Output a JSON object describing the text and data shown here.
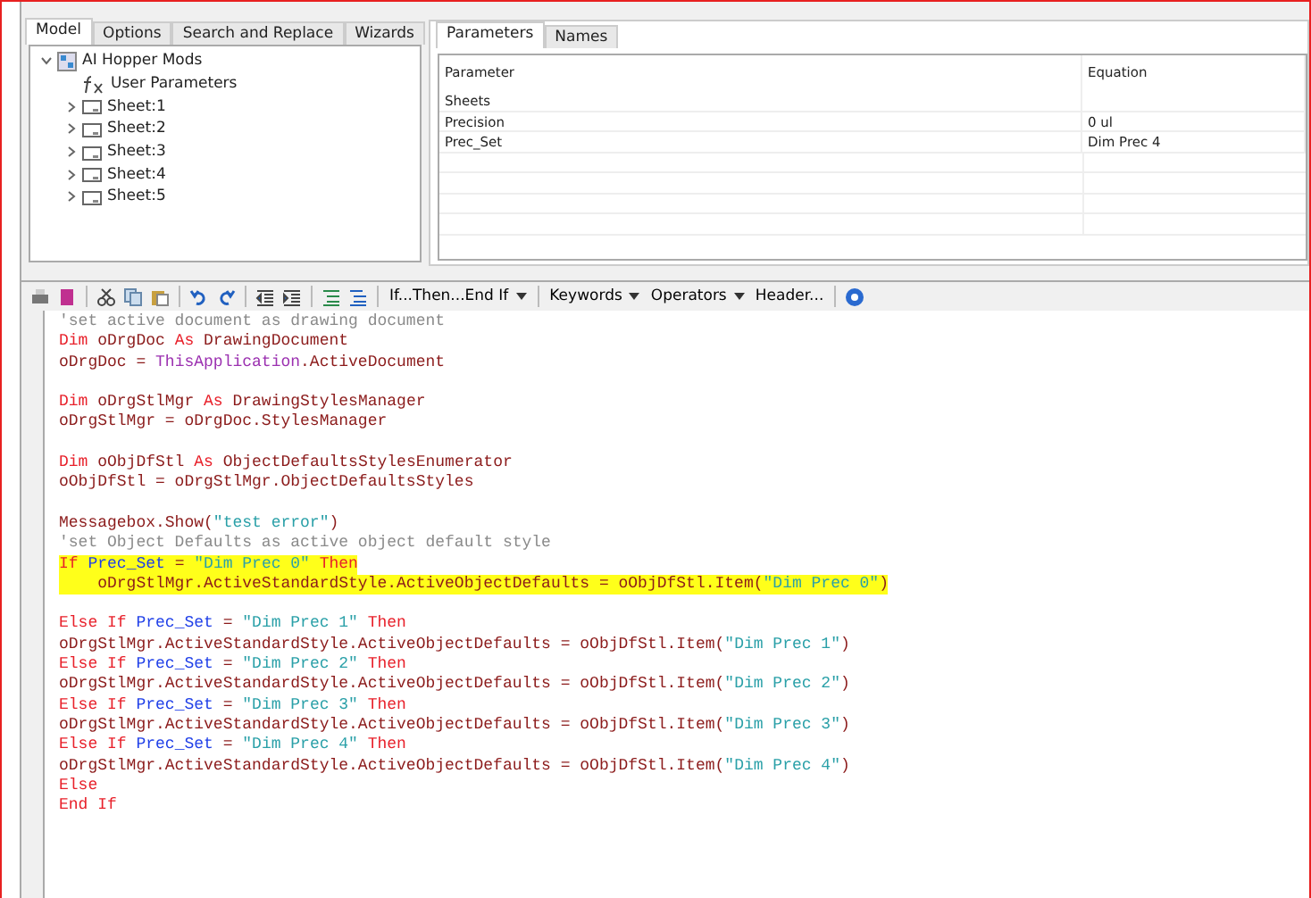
{
  "main_tabs": [
    {
      "label": "Model",
      "selected": true
    },
    {
      "label": "Options",
      "selected": false
    },
    {
      "label": "Search and Replace",
      "selected": false
    },
    {
      "label": "Wizards",
      "selected": false
    }
  ],
  "tree": [
    {
      "label": "AI Hopper Mods",
      "kind": "assembly",
      "expanded": true,
      "children": [
        {
          "label": "User Parameters",
          "kind": "parameters"
        },
        {
          "label": "Sheet:1",
          "kind": "sheet",
          "expanded": false
        },
        {
          "label": "Sheet:2",
          "kind": "sheet",
          "expanded": false
        },
        {
          "label": "Sheet:3",
          "kind": "sheet",
          "expanded": false
        },
        {
          "label": "Sheet:4",
          "kind": "sheet",
          "expanded": false
        },
        {
          "label": "Sheet:5",
          "kind": "sheet",
          "expanded": false
        }
      ]
    }
  ],
  "param_tabs": [
    {
      "label": "Parameters",
      "selected": true
    },
    {
      "label": "Names",
      "selected": false
    }
  ],
  "param_table": {
    "columns": [
      "Parameter",
      "Equation"
    ],
    "rows": [
      [
        "Sheets",
        ""
      ],
      [
        "Precision",
        "0 ul"
      ],
      [
        "Prec_Set",
        "Dim Prec 4"
      ]
    ]
  },
  "toolbar": [
    {
      "label": "If...Then...End If",
      "dropdown": true
    },
    {
      "label": "Keywords",
      "dropdown": true
    },
    {
      "label": "Operators",
      "dropdown": true
    },
    {
      "label": "Header...",
      "dropdown": false
    }
  ],
  "code": [
    {
      "highlighted": false,
      "tokens": [
        {
          "kind": "comment",
          "text": "'set active document as drawing document"
        }
      ]
    },
    {
      "highlighted": false,
      "tokens": [
        {
          "kind": "kw",
          "text": "Dim"
        },
        {
          "kind": "id",
          "text": " oDrgDoc "
        },
        {
          "kind": "kw",
          "text": "As"
        },
        {
          "kind": "id",
          "text": " DrawingDocument"
        }
      ]
    },
    {
      "highlighted": false,
      "tokens": [
        {
          "kind": "id",
          "text": "oDrgDoc = "
        },
        {
          "kind": "obj",
          "text": "ThisApplication"
        },
        {
          "kind": "id",
          "text": ".ActiveDocument"
        }
      ]
    },
    {
      "highlighted": false
    },
    {
      "highlighted": false,
      "tokens": [
        {
          "kind": "kw",
          "text": "Dim"
        },
        {
          "kind": "id",
          "text": " oDrgStlMgr "
        },
        {
          "kind": "kw",
          "text": "As"
        },
        {
          "kind": "id",
          "text": " DrawingStylesManager"
        }
      ]
    },
    {
      "highlighted": false,
      "tokens": [
        {
          "kind": "id",
          "text": "oDrgStlMgr = oDrgDoc.StylesManager"
        }
      ]
    },
    {
      "highlighted": false
    },
    {
      "highlighted": false,
      "tokens": [
        {
          "kind": "kw",
          "text": "Dim"
        },
        {
          "kind": "id",
          "text": " oObjDfStl "
        },
        {
          "kind": "kw",
          "text": "As"
        },
        {
          "kind": "id",
          "text": " ObjectDefaultsStylesEnumerator"
        }
      ]
    },
    {
      "highlighted": false,
      "tokens": [
        {
          "kind": "id",
          "text": "oObjDfStl = oDrgStlMgr.ObjectDefaultsStyles"
        }
      ]
    },
    {
      "highlighted": false
    },
    {
      "highlighted": false,
      "tokens": [
        {
          "kind": "id",
          "text": "Messagebox.Show("
        },
        {
          "kind": "str",
          "text": "\"test error\""
        },
        {
          "kind": "id",
          "text": ")"
        }
      ]
    },
    {
      "highlighted": false,
      "tokens": [
        {
          "kind": "comment",
          "text": "'set Object Defaults as active object default style"
        }
      ]
    },
    {
      "highlighted": true,
      "tokens": [
        {
          "kind": "kw",
          "text": "If"
        },
        {
          "kind": "var",
          "text": " Prec_Set "
        },
        {
          "kind": "id",
          "text": "= "
        },
        {
          "kind": "str",
          "text": "\"Dim Prec 0\""
        },
        {
          "kind": "kw",
          "text": " Then"
        }
      ]
    },
    {
      "highlighted": true,
      "tokens": [
        {
          "kind": "id",
          "text": "    oDrgStlMgr.ActiveStandardStyle.ActiveObjectDefaults = oObjDfStl.Item("
        },
        {
          "kind": "str",
          "text": "\"Dim Prec 0\""
        },
        {
          "kind": "id",
          "text": ")"
        }
      ]
    },
    {
      "highlighted": false
    },
    {
      "highlighted": false,
      "tokens": [
        {
          "kind": "kw",
          "text": "Else If"
        },
        {
          "kind": "var",
          "text": " Prec_Set "
        },
        {
          "kind": "id",
          "text": "= "
        },
        {
          "kind": "str",
          "text": "\"Dim Prec 1\""
        },
        {
          "kind": "kw",
          "text": " Then"
        }
      ]
    },
    {
      "highlighted": false,
      "tokens": [
        {
          "kind": "id",
          "text": "oDrgStlMgr.ActiveStandardStyle.ActiveObjectDefaults = oObjDfStl.Item("
        },
        {
          "kind": "str",
          "text": "\"Dim Prec 1\""
        },
        {
          "kind": "id",
          "text": ")"
        }
      ]
    },
    {
      "highlighted": false,
      "tokens": [
        {
          "kind": "kw",
          "text": "Else If"
        },
        {
          "kind": "var",
          "text": " Prec_Set "
        },
        {
          "kind": "id",
          "text": "= "
        },
        {
          "kind": "str",
          "text": "\"Dim Prec 2\""
        },
        {
          "kind": "kw",
          "text": " Then"
        }
      ]
    },
    {
      "highlighted": false,
      "tokens": [
        {
          "kind": "id",
          "text": "oDrgStlMgr.ActiveStandardStyle.ActiveObjectDefaults = oObjDfStl.Item("
        },
        {
          "kind": "str",
          "text": "\"Dim Prec 2\""
        },
        {
          "kind": "id",
          "text": ")"
        }
      ]
    },
    {
      "highlighted": false,
      "tokens": [
        {
          "kind": "kw",
          "text": "Else If"
        },
        {
          "kind": "var",
          "text": " Prec_Set "
        },
        {
          "kind": "id",
          "text": "= "
        },
        {
          "kind": "str",
          "text": "\"Dim Prec 3\""
        },
        {
          "kind": "kw",
          "text": " Then"
        }
      ]
    },
    {
      "highlighted": false,
      "tokens": [
        {
          "kind": "id",
          "text": "oDrgStlMgr.ActiveStandardStyle.ActiveObjectDefaults = oObjDfStl.Item("
        },
        {
          "kind": "str",
          "text": "\"Dim Prec 3\""
        },
        {
          "kind": "id",
          "text": ")"
        }
      ]
    },
    {
      "highlighted": false,
      "tokens": [
        {
          "kind": "kw",
          "text": "Else If"
        },
        {
          "kind": "var",
          "text": " Prec_Set "
        },
        {
          "kind": "id",
          "text": "= "
        },
        {
          "kind": "str",
          "text": "\"Dim Prec 4\""
        },
        {
          "kind": "kw",
          "text": " Then"
        }
      ]
    },
    {
      "highlighted": false,
      "tokens": [
        {
          "kind": "id",
          "text": "oDrgStlMgr.ActiveStandardStyle.ActiveObjectDefaults = oObjDfStl.Item("
        },
        {
          "kind": "str",
          "text": "\"Dim Prec 4\""
        },
        {
          "kind": "id",
          "text": ")"
        }
      ]
    },
    {
      "highlighted": false,
      "tokens": [
        {
          "kind": "kw",
          "text": "Else"
        }
      ]
    },
    {
      "highlighted": false,
      "tokens": [
        {
          "kind": "kw",
          "text": "End If"
        }
      ]
    }
  ]
}
